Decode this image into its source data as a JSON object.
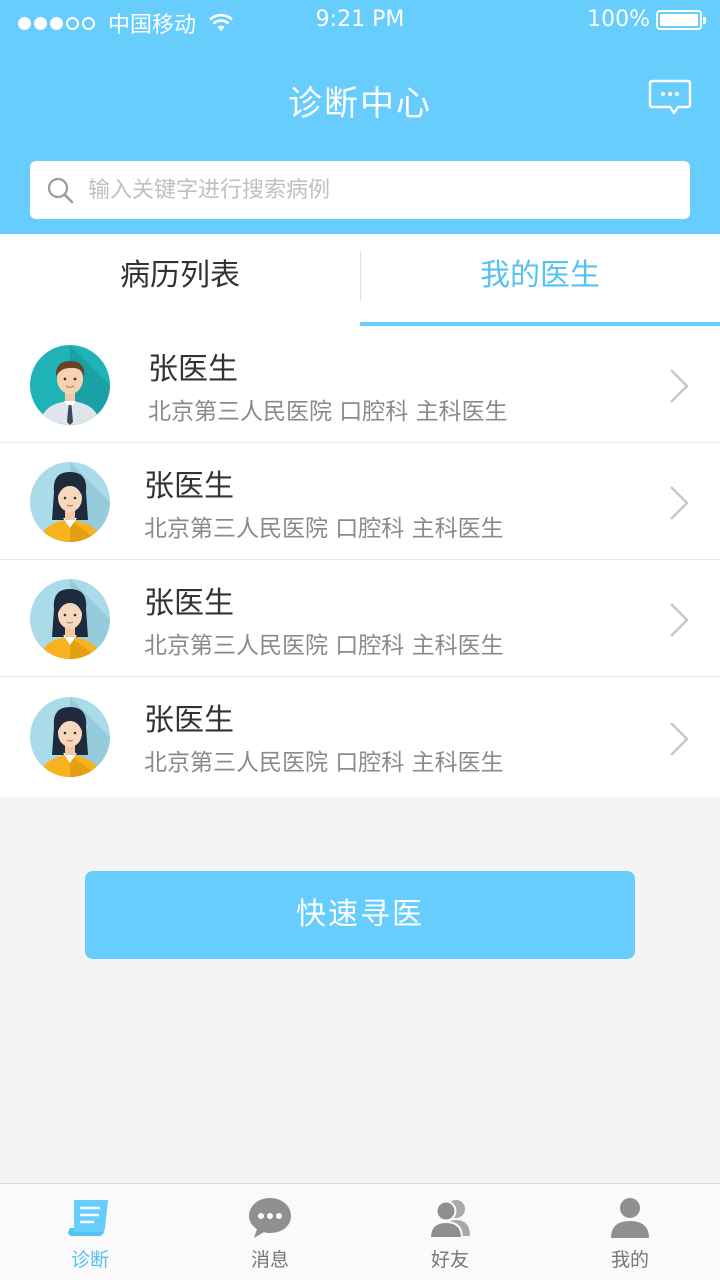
{
  "status_bar": {
    "carrier": "中国移动",
    "time": "9:21 PM",
    "battery": "100%"
  },
  "header": {
    "title": "诊断中心",
    "message_icon": "chat-bubble-icon"
  },
  "search": {
    "placeholder": "输入关键字进行搜索病例"
  },
  "tabs": [
    {
      "label": "病历列表",
      "active": false
    },
    {
      "label": "我的医生",
      "active": true
    }
  ],
  "doctors": [
    {
      "name": "张医生",
      "info": "北京第三人民医院 口腔科 主科医生",
      "avatar": "male-doctor-avatar"
    },
    {
      "name": "张医生",
      "info": "北京第三人民医院 口腔科 主科医生",
      "avatar": "female-doctor-avatar"
    },
    {
      "name": "张医生",
      "info": "北京第三人民医院 口腔科 主科医生",
      "avatar": "female-doctor-avatar"
    },
    {
      "name": "张医生",
      "info": "北京第三人民医院 口腔科 主科医生",
      "avatar": "female-doctor-avatar"
    }
  ],
  "quick_button": {
    "label": "快速寻医"
  },
  "tabbar": [
    {
      "label": "诊断",
      "icon": "document-icon",
      "active": true
    },
    {
      "label": "消息",
      "icon": "chat-icon",
      "active": false
    },
    {
      "label": "好友",
      "icon": "friends-icon",
      "active": false
    },
    {
      "label": "我的",
      "icon": "person-icon",
      "active": false
    }
  ],
  "colors": {
    "primary": "#66cdfd",
    "active_text": "#56c2f2",
    "inactive_tab_icon": "#8f8f8f",
    "background": "#f4f4f4"
  }
}
